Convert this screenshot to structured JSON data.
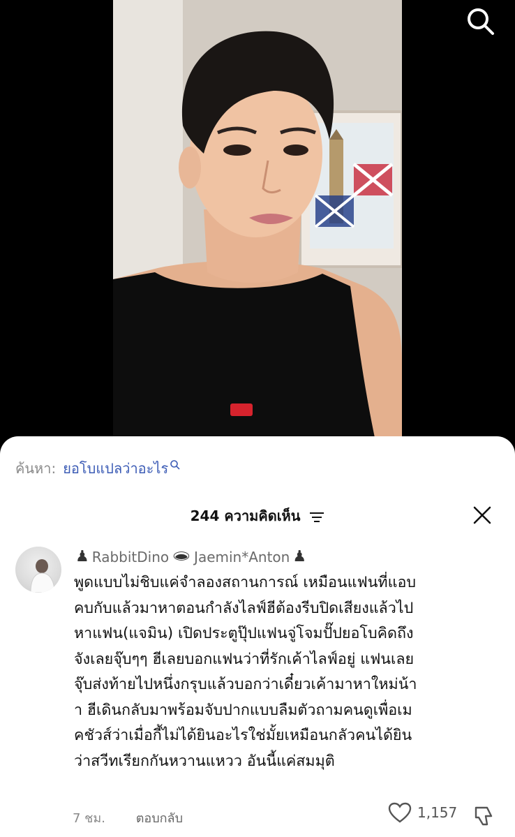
{
  "search": {
    "label": "ค้นหา:",
    "query": "ยอโบแปลว่าอะไร"
  },
  "comments": {
    "count": "244",
    "label": "ความคิดเห็น"
  },
  "comment": {
    "username": "RabbitDino",
    "username2": "Jaemin*Anton",
    "sym_pawn": "♟",
    "sym_hole": "🕳",
    "lines": [
      "พูดแบบไม่ชิบแค่จำลองสถานการณ์ เหมือนแฟนที่แอบ",
      "คบกับแล้วมาหาตอนกำลังไลฟ์ฮีต้องรีบปิดเสียงแล้วไป",
      "หาแฟน(แจมิน) เปิดประตูปุ๊ปแฟนจู่โจมปั๊ปยอโบคิดถึง",
      "จังเลยจุ๊บๆๆ ฮีเลยบอกแฟนว่าที่รักเค้าไลฟ์อยู่ แฟนเลย",
      "จุ๊บส่งท้ายไปหนึ่งกรุบแล้วบอกว่าเดี๋ยวเค้ามาหาใหม่น้า",
      "า ฮีเดินกลับมาพร้อมจับปากแบบลืมตัวถามคนดูเพื่อเม",
      "คชัวส์ว่าเมื่อกี้ไม่ได้ยินอะไรใช่มั้ยเหมือนกลัวคนได้ยิน",
      "ว่าสวีทเรียกกันหวานแหวว อันนี้แค่สมมุติ"
    ],
    "time": "7 ชม.",
    "reply": "ตอบกลับ",
    "likes": "1,157"
  },
  "colors": {
    "accent": "#3b5bb5",
    "sheet": "#ffffff",
    "background": "#000000"
  }
}
